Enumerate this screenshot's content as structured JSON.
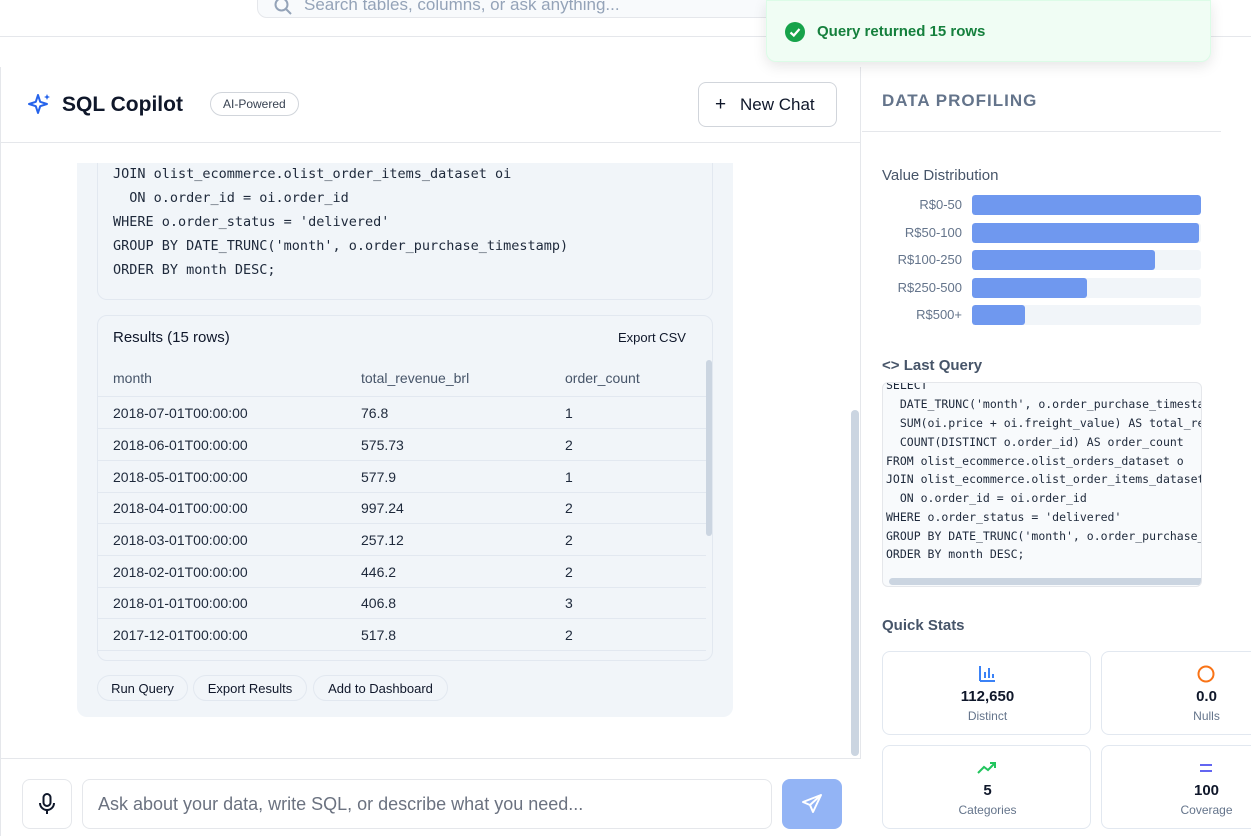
{
  "search": {
    "placeholder": "Search tables, columns, or ask anything..."
  },
  "toast": {
    "message": "Query returned 15 rows",
    "color": "#16a34a"
  },
  "chat": {
    "title": "SQL Copilot",
    "badge": "AI-Powered",
    "new_chat_label": "New Chat",
    "sql_lines": [
      "JOIN olist_ecommerce.olist_order_items_dataset oi",
      "  ON o.order_id = oi.order_id",
      "WHERE o.order_status = 'delivered'",
      "GROUP BY DATE_TRUNC('month', o.order_purchase_timestamp)",
      "ORDER BY month DESC;"
    ],
    "results": {
      "title": "Results (15 rows)",
      "export_label": "Export CSV",
      "columns": [
        "month",
        "total_revenue_brl",
        "order_count"
      ],
      "rows": [
        [
          "2018-07-01T00:00:00",
          "76.8",
          "1"
        ],
        [
          "2018-06-01T00:00:00",
          "575.73",
          "2"
        ],
        [
          "2018-05-01T00:00:00",
          "577.9",
          "1"
        ],
        [
          "2018-04-01T00:00:00",
          "997.24",
          "2"
        ],
        [
          "2018-03-01T00:00:00",
          "257.12",
          "2"
        ],
        [
          "2018-02-01T00:00:00",
          "446.2",
          "2"
        ],
        [
          "2018-01-01T00:00:00",
          "406.8",
          "3"
        ],
        [
          "2017-12-01T00:00:00",
          "517.8",
          "2"
        ]
      ]
    },
    "actions": [
      "Run Query",
      "Export Results",
      "Add to Dashboard"
    ],
    "input_placeholder": "Ask about your data, write SQL, or describe what you need..."
  },
  "profiling": {
    "title": "DATA PROFILING",
    "value_distribution": {
      "title": "Value Distribution",
      "bars": [
        {
          "label": "R$0-50",
          "fraction": 1.0
        },
        {
          "label": "R$50-100",
          "fraction": 0.99
        },
        {
          "label": "R$100-250",
          "fraction": 0.8
        },
        {
          "label": "R$250-500",
          "fraction": 0.5
        },
        {
          "label": "R$500+",
          "fraction": 0.23
        }
      ],
      "bar_color": "#6f98ef"
    },
    "last_query": {
      "title": "Last Query",
      "lines": [
        "SELECT",
        "  DATE_TRUNC('month', o.order_purchase_timesta",
        "  SUM(oi.price + oi.freight_value) AS total_re",
        "  COUNT(DISTINCT o.order_id) AS order_count",
        "FROM olist_ecommerce.olist_orders_dataset o",
        "JOIN olist_ecommerce.olist_order_items_dataset",
        "  ON o.order_id = oi.order_id",
        "WHERE o.order_status = 'delivered'",
        "GROUP BY DATE_TRUNC('month', o.order_purchase_",
        "ORDER BY month DESC;"
      ]
    },
    "quick_stats": {
      "title": "Quick Stats",
      "cards": [
        {
          "icon": "bar-chart-icon",
          "value": "112,650",
          "label": "Distinct",
          "color": "#3b82f6"
        },
        {
          "icon": "circle-icon",
          "value": "0.0",
          "label": "Nulls",
          "color": "#f97316"
        },
        {
          "icon": "trending-up-icon",
          "value": "5",
          "label": "Categories",
          "color": "#22c55e"
        },
        {
          "icon": "equals-icon",
          "value": "100",
          "label": "Coverage",
          "color": "#6366f1"
        }
      ]
    }
  }
}
